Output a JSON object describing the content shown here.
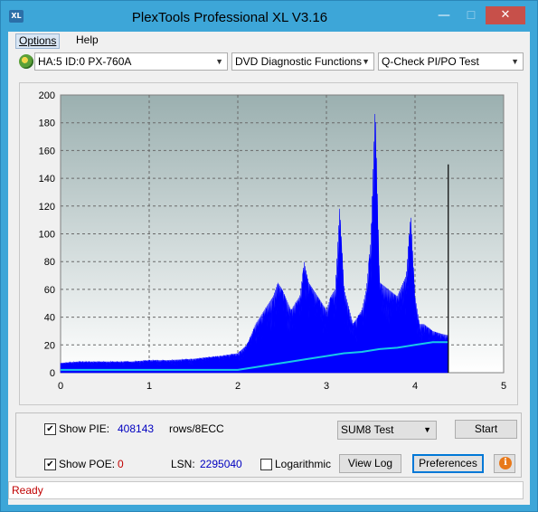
{
  "window": {
    "title": "PlexTools Professional XL V3.16",
    "app_icon_text": "XL",
    "minimize_symbol": "—",
    "maximize_symbol": "☐",
    "close_symbol": "✕"
  },
  "menu": {
    "items": [
      {
        "label": "Options"
      },
      {
        "label": "Help"
      }
    ]
  },
  "toolbar": {
    "drive": "HA:5 ID:0  PX-760A",
    "function": "DVD Diagnostic Functions",
    "test": "Q-Check PI/PO Test"
  },
  "chart_data": {
    "type": "area",
    "x_ticks": [
      "0",
      "1",
      "2",
      "3",
      "4",
      "5"
    ],
    "y_ticks": [
      "0",
      "20",
      "40",
      "60",
      "80",
      "100",
      "120",
      "140",
      "160",
      "180",
      "200"
    ],
    "xlim": [
      0,
      5
    ],
    "ylim": [
      0,
      200
    ],
    "grid": true,
    "colors": {
      "pie": "#0000ff",
      "pif_avg": "#18c8e8",
      "end_marker": "#000000"
    },
    "series": [
      {
        "name": "PIE",
        "x": [
          0,
          0.2,
          0.5,
          0.8,
          1.0,
          1.2,
          1.5,
          1.8,
          2.0,
          2.1,
          2.2,
          2.3,
          2.4,
          2.45,
          2.5,
          2.6,
          2.7,
          2.75,
          2.8,
          2.9,
          3.0,
          3.05,
          3.1,
          3.15,
          3.2,
          3.3,
          3.4,
          3.45,
          3.5,
          3.55,
          3.6,
          3.7,
          3.8,
          3.9,
          3.95,
          4.0,
          4.05,
          4.1,
          4.2,
          4.3,
          4.37
        ],
        "y": [
          7,
          8,
          8,
          8,
          9,
          9,
          10,
          12,
          14,
          20,
          35,
          45,
          55,
          65,
          60,
          45,
          55,
          80,
          65,
          55,
          45,
          55,
          60,
          120,
          60,
          35,
          45,
          60,
          95,
          195,
          65,
          60,
          55,
          70,
          115,
          55,
          35,
          35,
          30,
          28,
          27
        ]
      },
      {
        "name": "PIF average",
        "x": [
          0,
          0.5,
          1.0,
          1.5,
          2.0,
          2.2,
          2.4,
          2.6,
          2.8,
          3.0,
          3.2,
          3.4,
          3.6,
          3.8,
          4.0,
          4.2,
          4.37
        ],
        "y": [
          2,
          2,
          2,
          2,
          2,
          4,
          6,
          8,
          10,
          12,
          14,
          15,
          17,
          18,
          20,
          22,
          22
        ]
      }
    ],
    "end_marker": {
      "x": 4.37,
      "y": 150
    }
  },
  "panel": {
    "show_pie_label": "Show PIE:",
    "pie_value": "408143",
    "pie_unit": "rows/8ECC",
    "show_poe_label": "Show POE:",
    "poe_value": "0",
    "lsn_label": "LSN:",
    "lsn_value": "2295040",
    "logarithmic_label": "Logarithmic",
    "show_pie_checked": true,
    "show_poe_checked": true,
    "logarithmic_checked": false,
    "sum_select": "SUM8 Test",
    "start_button": "Start",
    "view_log_button": "View Log",
    "preferences_button": "Preferences",
    "info_symbol": "i",
    "check_mark": "✔"
  },
  "status": {
    "text": "Ready"
  }
}
